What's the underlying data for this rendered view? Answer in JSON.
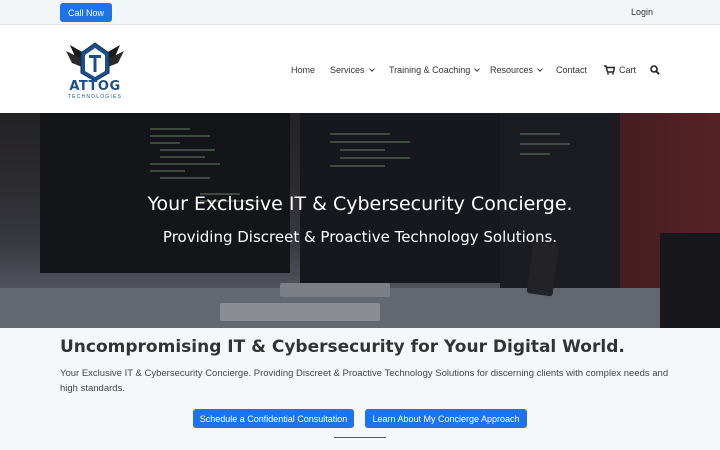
{
  "topbar": {
    "call_label": "Call Now",
    "login_label": "Login"
  },
  "brand": {
    "name": "ATTOG",
    "tagline": "TECHNOLOGIES",
    "colors": {
      "primary": "#1b4f8c",
      "accent": "#1e73e8"
    }
  },
  "nav": {
    "items": [
      {
        "label": "Home",
        "dropdown": false
      },
      {
        "label": "Services",
        "dropdown": true
      },
      {
        "label": "Training & Coaching",
        "dropdown": true
      },
      {
        "label": "Resources",
        "dropdown": true
      },
      {
        "label": "Contact",
        "dropdown": false
      },
      {
        "label": "Cart",
        "icon": "cart-icon"
      }
    ],
    "search_icon": "search-icon"
  },
  "hero": {
    "title": "Your Exclusive IT & Cybersecurity Concierge.",
    "subtitle": "Providing Discreet & Proactive Technology Solutions."
  },
  "content": {
    "heading": "Uncompromising IT & Cybersecurity for Your Digital World.",
    "body": "Your Exclusive IT & Cybersecurity Concierge. Providing Discreet & Proactive Technology Solutions for discerning clients with complex needs and high standards.",
    "buttons": {
      "consultation": "Schedule a Confidential Consultation",
      "approach": "Learn About My Concierge Approach"
    }
  }
}
